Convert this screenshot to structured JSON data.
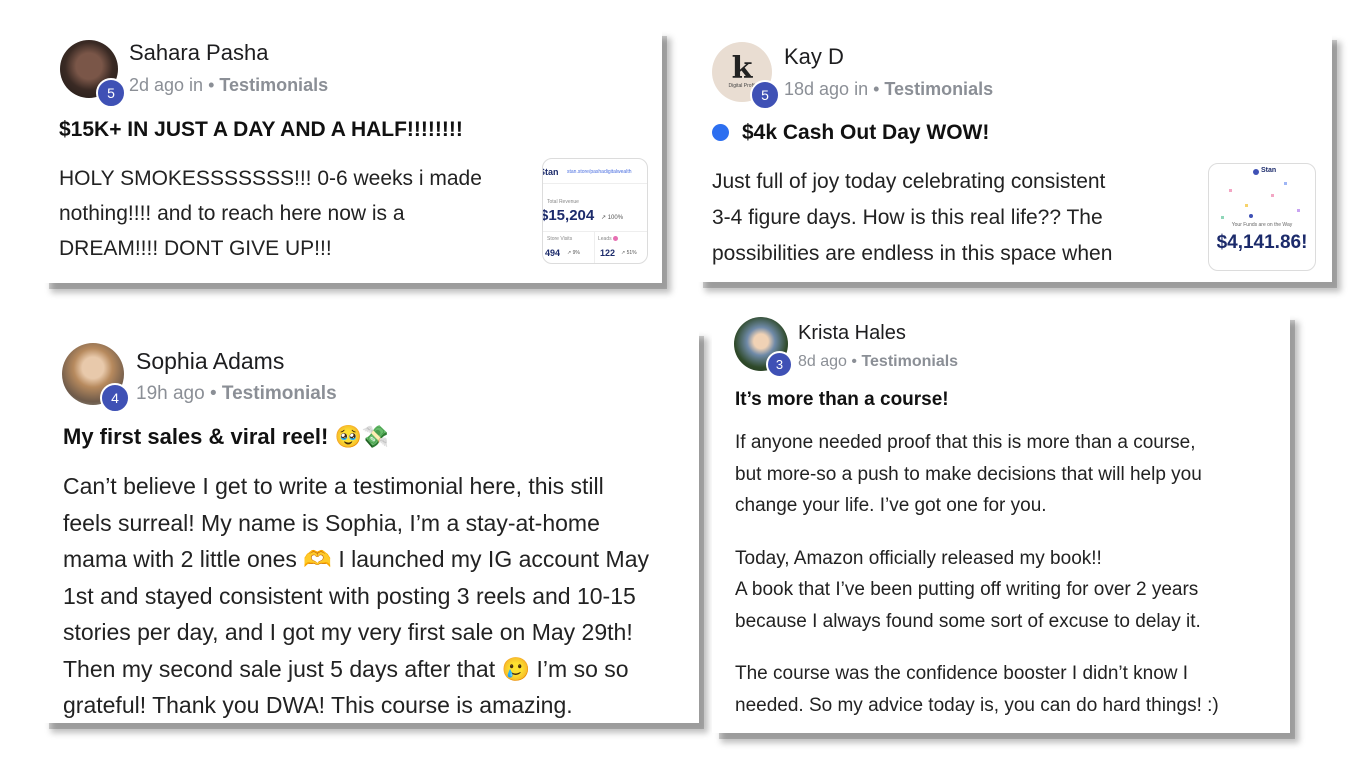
{
  "posts": [
    {
      "author": "Sahara Pasha",
      "level": "5",
      "time": "2d ago in",
      "category": "Testimonials",
      "title": "$15K+ IN JUST A DAY AND A HALF!!!!!!!!",
      "lines": [
        "HOLY SMOKESSSSSSS!!! 0-6 weeks i made",
        "nothing!!!! and to reach here now is a",
        "DREAM!!!! DONT GIVE UP!!!"
      ],
      "thumb": {
        "brand": "Stan",
        "url": "stan.store/pashadigitalwealth",
        "revenue_label": "Total Revenue",
        "revenue": "$15,204",
        "revenue_change": "↗ 100%",
        "visits_label": "Store Visits",
        "visits": "494",
        "visits_change": "↗ 9%",
        "leads_label": "Leads",
        "leads": "122",
        "leads_change": "↗ 51%"
      }
    },
    {
      "author": "Kay D",
      "level": "5",
      "time": "18d ago in",
      "category": "Testimonials",
      "title": "$4k Cash Out Day WOW!",
      "lines": [
        "Just full of joy today celebrating consistent",
        "3-4 figure days. How is this real life?? The",
        "possibilities are endless in this space when"
      ],
      "thumb": {
        "brand": "Stan",
        "caption": "Your Funds are on the Way",
        "amount": "$4,141.86!"
      }
    },
    {
      "author": "Sophia Adams",
      "level": "4",
      "time": "19h ago",
      "category": "Testimonials",
      "title": "My first sales & viral reel! 🥹💸",
      "lines": [
        "Can’t believe I get to write a testimonial here, this still",
        "feels surreal! My name is Sophia, I’m a stay-at-home",
        "mama with 2 little ones 🫶 I launched my IG account May",
        "1st and stayed consistent with posting 3 reels and 10-15",
        "stories per day, and I got my very first sale on May 29th!",
        "Then my second sale just 5 days after that 🥲 I’m so so",
        "grateful! Thank you DWA! This course is amazing."
      ]
    },
    {
      "author": "Krista Hales",
      "level": "3",
      "time": "8d ago",
      "category": "Testimonials",
      "title": "It’s more than a course!",
      "para1": [
        "If anyone needed proof that this is more than a course,",
        "but more-so a push to make decisions that will help you",
        "change your life. I’ve got one for you."
      ],
      "para2": [
        "Today, Amazon officially released my book!!",
        "A book that I’ve been putting off writing for over 2 years",
        "because I always found some sort of excuse to delay it."
      ],
      "para3": [
        "The course was the confidence booster I didn’t know I",
        "needed. So my advice today is, you can do hard things! :)"
      ]
    }
  ],
  "kay_logo_letter": "k",
  "kay_logo_caption": "Digital Profit",
  "colors": {
    "level_badge": "#3f51b5",
    "meta_text": "#8b8f96",
    "unread_dot": "#2d6ff0",
    "stan_navy": "#1c2b6b"
  }
}
